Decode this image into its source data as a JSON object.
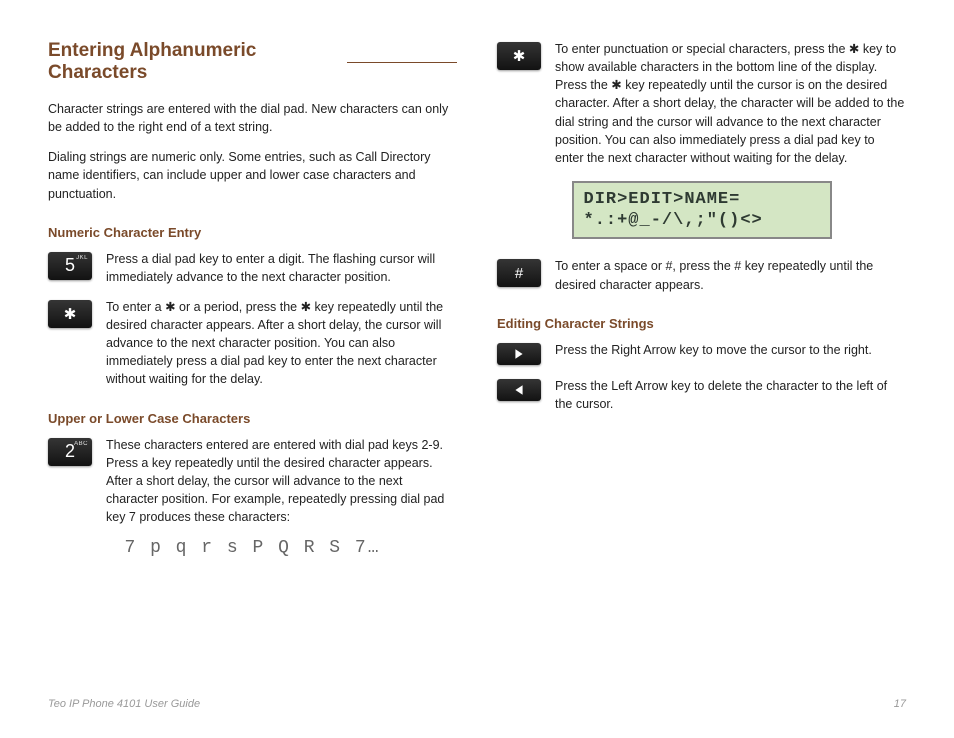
{
  "title": "Entering Alphanumeric Characters",
  "intro1": "Character strings are entered with the dial pad. New characters can only be added to the right end of a text string.",
  "intro2": "Dialing strings are numeric only. Some entries, such as Call Directory name identifiers, can include upper and lower case characters and punctuation.",
  "sections": {
    "numeric": {
      "heading": "Numeric Character Entry",
      "key5": {
        "main": "5",
        "sup": "JKL",
        "text": "Press a dial pad key to enter a digit. The flashing cursor will immediately advance to the next character position."
      },
      "keyStar": {
        "main": "✱",
        "text": "To enter a ✱ or a period, press the ✱ key repeatedly until the desired character appears. After a short delay, the cursor will advance to the next character position. You can also immediately press a dial pad key to enter the next character without waiting for the delay."
      }
    },
    "case": {
      "heading": "Upper or Lower Case Characters",
      "key2": {
        "main": "2",
        "sup": "ABC",
        "text": "These characters entered are entered with dial pad keys 2-9. Press a key repeatedly until the desired character appears. After a short delay, the cursor will advance to the next character position. For example, repeatedly pressing dial pad key 7 produces these characters:"
      },
      "segment": "7 p q r s P Q R S 7…"
    },
    "punct": {
      "keyStar": {
        "main": "✱",
        "text": "To enter punctuation or special characters, press the ✱ key to show available characters in the bottom line of the display. Press the ✱ key repeatedly until the cursor is on the desired character. After a short delay, the character will be added to the dial string and the cursor will advance to the next character position. You can also immediately press a dial pad key to enter the next character without waiting for the delay."
      },
      "lcd1": "DIR>EDIT>NAME=",
      "lcd2": "*.:+@_-/\\,;\"()<>",
      "keyHash": {
        "main": "#",
        "text": "To enter a space or #, press the # key repeatedly until the desired character appears."
      }
    },
    "edit": {
      "heading": "Editing Character Strings",
      "right": "Press the Right Arrow key to move the cursor to the right.",
      "left": "Press the Left Arrow key to delete the character to the left of the cursor."
    }
  },
  "footer": {
    "left": "Teo IP Phone 4101 User Guide",
    "right": "17"
  }
}
